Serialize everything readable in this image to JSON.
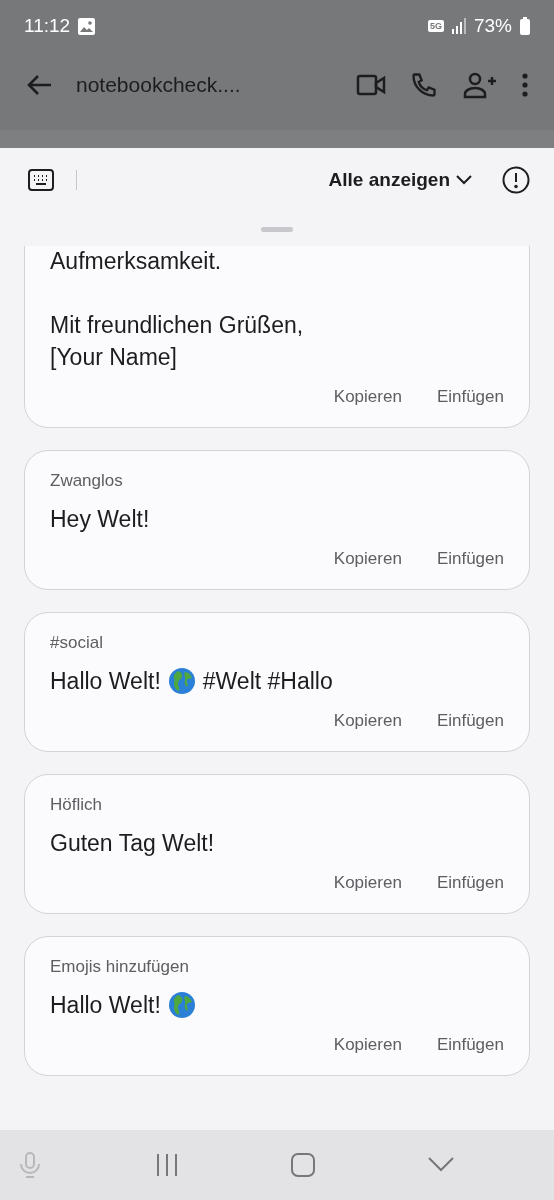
{
  "status_bar": {
    "time": "11:12",
    "network": "5G",
    "battery": "73%"
  },
  "app_bar": {
    "title": "notebookcheck...."
  },
  "panel": {
    "filter": "Alle anzeigen"
  },
  "suggestions": [
    {
      "body": [
        {
          "kind": "text",
          "text": "Aufmerksamkeit.\n\nMit freundlichen Grüßen,\n[Your Name]"
        }
      ],
      "actions": [
        "Kopieren",
        "Einfügen"
      ]
    },
    {
      "label": "Zwanglos",
      "body": [
        {
          "kind": "text",
          "text": "Hey Welt!"
        }
      ],
      "actions": [
        "Kopieren",
        "Einfügen"
      ]
    },
    {
      "label": "#social",
      "body": [
        {
          "kind": "text",
          "text": "Hallo Welt!"
        },
        {
          "kind": "globe"
        },
        {
          "kind": "text",
          "text": "#Welt #Hallo"
        }
      ],
      "actions": [
        "Kopieren",
        "Einfügen"
      ]
    },
    {
      "label": "Höflich",
      "body": [
        {
          "kind": "text",
          "text": "Guten Tag Welt!"
        }
      ],
      "actions": [
        "Kopieren",
        "Einfügen"
      ]
    },
    {
      "label": "Emojis hinzufügen",
      "body": [
        {
          "kind": "text",
          "text": "Hallo Welt!"
        },
        {
          "kind": "globe"
        }
      ],
      "actions": [
        "Kopieren",
        "Einfügen"
      ]
    }
  ]
}
